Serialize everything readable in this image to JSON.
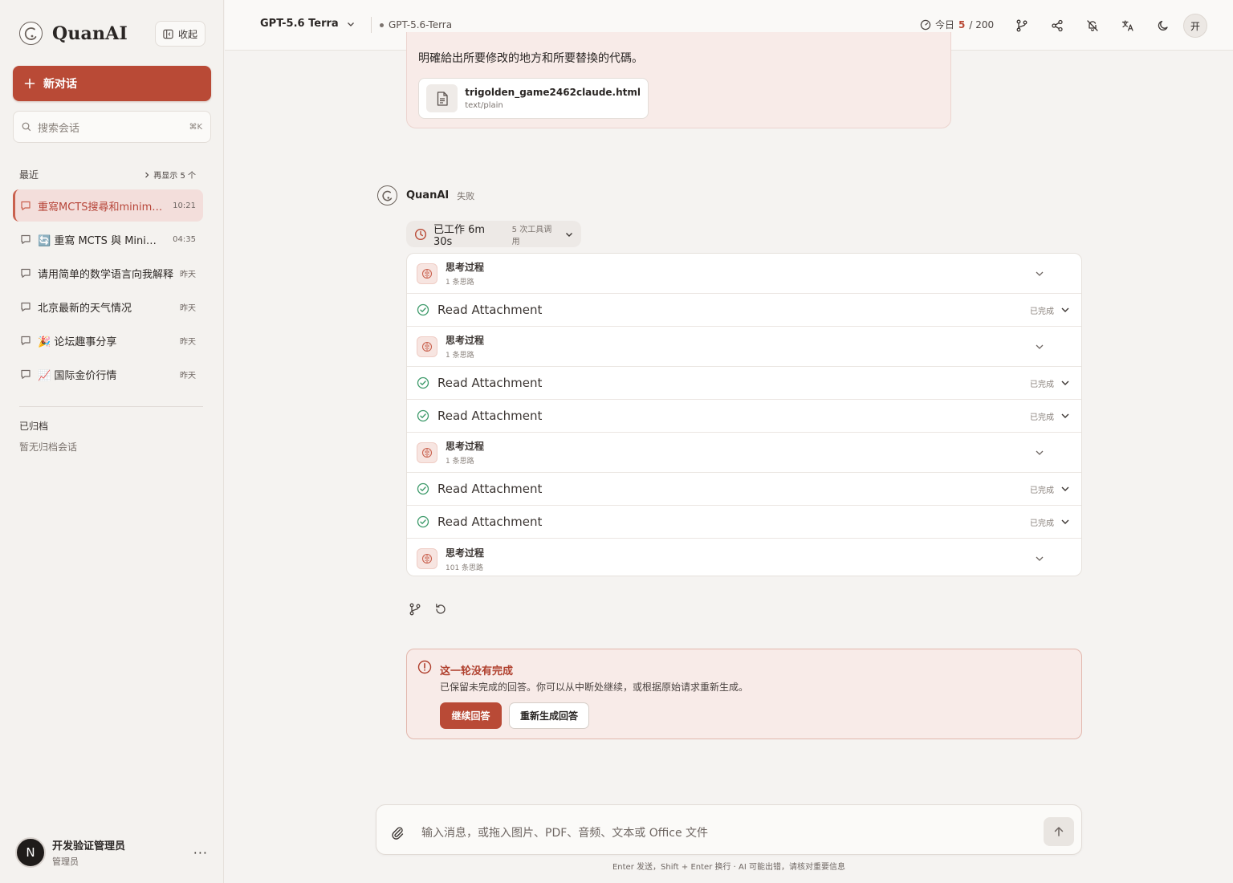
{
  "sidebar": {
    "brand": "QuanAI",
    "collapse_label": "收起",
    "new_chat_label": "新对话",
    "search": {
      "placeholder": "搜索会话",
      "shortcut": "⌘K"
    },
    "recent_label": "最近",
    "show_more_label": "再显示 5 个",
    "conversations": [
      {
        "title": "重寫MCTS搜尋和minimax算法",
        "time": "10:21",
        "active": true
      },
      {
        "title": "🔄 重寫 MCTS 與 Minimax",
        "time": "04:35"
      },
      {
        "title": "请用简单的数学语言向我解释",
        "time": "昨天"
      },
      {
        "title": "北京最新的天气情况",
        "time": "昨天"
      },
      {
        "title": "🎉 论坛趣事分享",
        "time": "昨天"
      },
      {
        "title": "📈 国际金价行情",
        "time": "昨天"
      }
    ],
    "archived_label": "已归档",
    "archived_empty": "暂无归档会话",
    "user": {
      "initial": "N",
      "name": "开发验证管理员",
      "role": "管理员",
      "menu": "···"
    }
  },
  "topbar": {
    "model_name": "GPT-5.6 Terra",
    "model_tag": "GPT-5.6-Terra",
    "quota_label": "今日",
    "quota_used": "5",
    "quota_total": "/ 200",
    "lang_label": "开"
  },
  "prev_message": {
    "text_tail": "明確給出所要修改的地方和所要替換的代碼。",
    "attachment": {
      "name": "trigolden_game2462claude.html",
      "type": "text/plain"
    }
  },
  "assistant": {
    "name": "QuanAI",
    "status": "失败",
    "worked_label": "已工作 6m 30s",
    "worked_sub": "5 次工具调用",
    "steps": [
      {
        "kind": "think",
        "title": "思考过程",
        "sub": "1 条思路"
      },
      {
        "kind": "tool",
        "title": "Read Attachment",
        "status": "已完成"
      },
      {
        "kind": "think",
        "title": "思考过程",
        "sub": "1 条思路"
      },
      {
        "kind": "tool",
        "title": "Read Attachment",
        "status": "已完成"
      },
      {
        "kind": "tool",
        "title": "Read Attachment",
        "status": "已完成"
      },
      {
        "kind": "think",
        "title": "思考过程",
        "sub": "1 条思路"
      },
      {
        "kind": "tool",
        "title": "Read Attachment",
        "status": "已完成"
      },
      {
        "kind": "tool",
        "title": "Read Attachment",
        "status": "已完成"
      },
      {
        "kind": "think",
        "title": "思考过程",
        "sub": "101 条思路"
      }
    ]
  },
  "warning": {
    "title": "这一轮没有完成",
    "text": "已保留未完成的回答。你可以从中断处继续，或根据原始请求重新生成。",
    "continue_label": "继续回答",
    "regenerate_label": "重新生成回答"
  },
  "composer": {
    "placeholder": "输入消息，或拖入图片、PDF、音频、文本或 Office 文件",
    "footnote": "Enter 发送，Shift + Enter 换行 · AI 可能出错，请核对重要信息"
  },
  "colors": {
    "accent": "#b94a36",
    "accent_soft": "#f8ebe8",
    "success": "#3d9a6a"
  }
}
